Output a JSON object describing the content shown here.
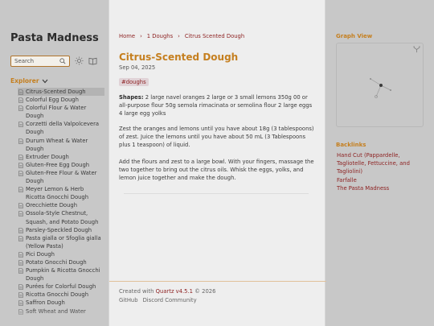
{
  "site": {
    "title": "Pasta Madness"
  },
  "search": {
    "placeholder": "Search"
  },
  "explorer": {
    "label": "Explorer",
    "items": [
      "Citrus-Scented Dough",
      "Colorful Egg Dough",
      "Colorful Flour & Water Dough",
      "Corzetti della Valpolcevera Dough",
      "Durum Wheat & Water Dough",
      "Extruder Dough",
      "Gluten-Free Egg Dough",
      "Gluten-Free Flour & Water Dough",
      "Meyer Lemon & Herb Ricotta Gnocchi Dough",
      "Orecchiette Dough",
      "Ossola-Style Chestnut, Squash, and Potato Dough",
      "Parsley-Speckled Dough",
      "Pasta gialla or Sfoglia gialla (Yellow Pasta)",
      "Pici Dough",
      "Potato Gnocchi Dough",
      "Pumpkin & Ricotta Gnocchi Dough",
      "Purées for Colorful Dough",
      "Ricotta Gnocchi Dough",
      "Saffron Dough",
      "Soft Wheat and Water"
    ]
  },
  "breadcrumb": {
    "items": [
      "Home",
      "1 Doughs",
      "Citrus Scented Dough"
    ],
    "separator": "›"
  },
  "article": {
    "title": "Citrus-Scented Dough",
    "date": "Sep 04, 2025",
    "tag": "#doughs",
    "shapes_label": "Shapes:",
    "shapes_text": "2 large navel oranges 2 large or 3 small lemons 350g 00 or all-purpose flour 50g semola rimacinata or semolina flour 2 large eggs 4 large egg yolks",
    "paragraph_1": "Zest the oranges and lemons until you have about 18g (3 tablespoons) of zest. Juice the lemons until you have about 50 mL (3 Tablespoons plus 1 teaspoon) of liquid.",
    "paragraph_2": "Add the flours and zest to a large bowl. With your fingers, massage the two together to bring out the citrus oils. Whisk the eggs, yolks, and lemon juice together and make the dough."
  },
  "footer": {
    "created_prefix": "Created with",
    "quartz_link": "Quartz v4.5.1",
    "copyright": "© 2026",
    "links": [
      "GitHub",
      "Discord Community"
    ]
  },
  "graph": {
    "title": "Graph View"
  },
  "backlinks": {
    "title": "Backlinks",
    "items": [
      "Hand Cut (Pappardelle, Tagliotelle, Fettuccine, and Tagliolini)",
      "Farfalle",
      "The Pasta Madness"
    ]
  },
  "colors": {
    "accent": "#c57f1f",
    "link": "#8c1f1f",
    "sidebar_bg": "#c8c8c8",
    "content_bg": "#eeeeee"
  }
}
